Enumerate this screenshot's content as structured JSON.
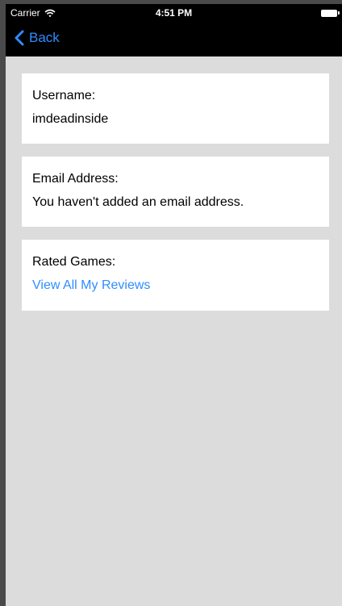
{
  "status_bar": {
    "carrier": "Carrier",
    "time": "4:51 PM",
    "wifi_icon": "wifi-icon",
    "battery_icon": "battery-icon"
  },
  "nav": {
    "back_label": "Back",
    "back_icon": "chevron-left-icon"
  },
  "profile": {
    "username_label": "Username:",
    "username_value": "imdeadinside",
    "email_label": "Email Address:",
    "email_value": "You haven't added an email address.",
    "rated_label": "Rated Games:",
    "rated_link": "View All My Reviews"
  },
  "colors": {
    "accent": "#2f8dff",
    "background": "#dcdcdc",
    "navbar": "#000000",
    "card": "#ffffff"
  }
}
